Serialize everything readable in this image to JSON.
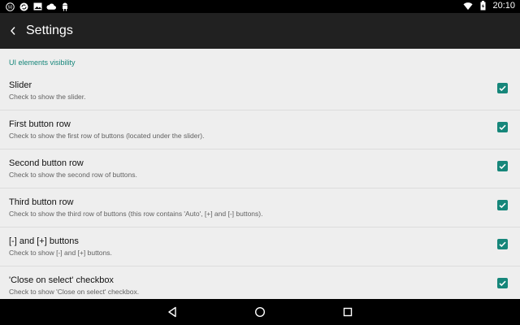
{
  "status_bar": {
    "time": "20:10",
    "left_icons": [
      "badge-50-icon",
      "sync-icon",
      "image-icon",
      "cloud-icon",
      "android-icon"
    ],
    "right_icons": [
      "wifi-icon",
      "battery-icon"
    ]
  },
  "app_bar": {
    "title": "Settings",
    "back_icon": "back-arrow-icon",
    "background": "#212121"
  },
  "settings": {
    "section_title": "UI elements visibility",
    "accent_color": "#16867a",
    "items": [
      {
        "title": "Slider",
        "summary": "Check to show the slider.",
        "checked": true
      },
      {
        "title": "First button row",
        "summary": "Check to show the first row of buttons (located under the slider).",
        "checked": true
      },
      {
        "title": "Second button row",
        "summary": "Check to show the second row of buttons.",
        "checked": true
      },
      {
        "title": "Third button row",
        "summary": "Check to show the third row of buttons (this row contains 'Auto', [+] and [-] buttons).",
        "checked": true
      },
      {
        "title": "[-] and [+] buttons",
        "summary": "Check to show [-] and [+] buttons.",
        "checked": true
      },
      {
        "title": "'Close on select' checkbox",
        "summary": "Check to show 'Close on select' checkbox.",
        "checked": true
      }
    ]
  },
  "nav_bar": {
    "buttons": [
      "back-triangle-icon",
      "home-circle-icon",
      "recents-square-icon"
    ]
  }
}
